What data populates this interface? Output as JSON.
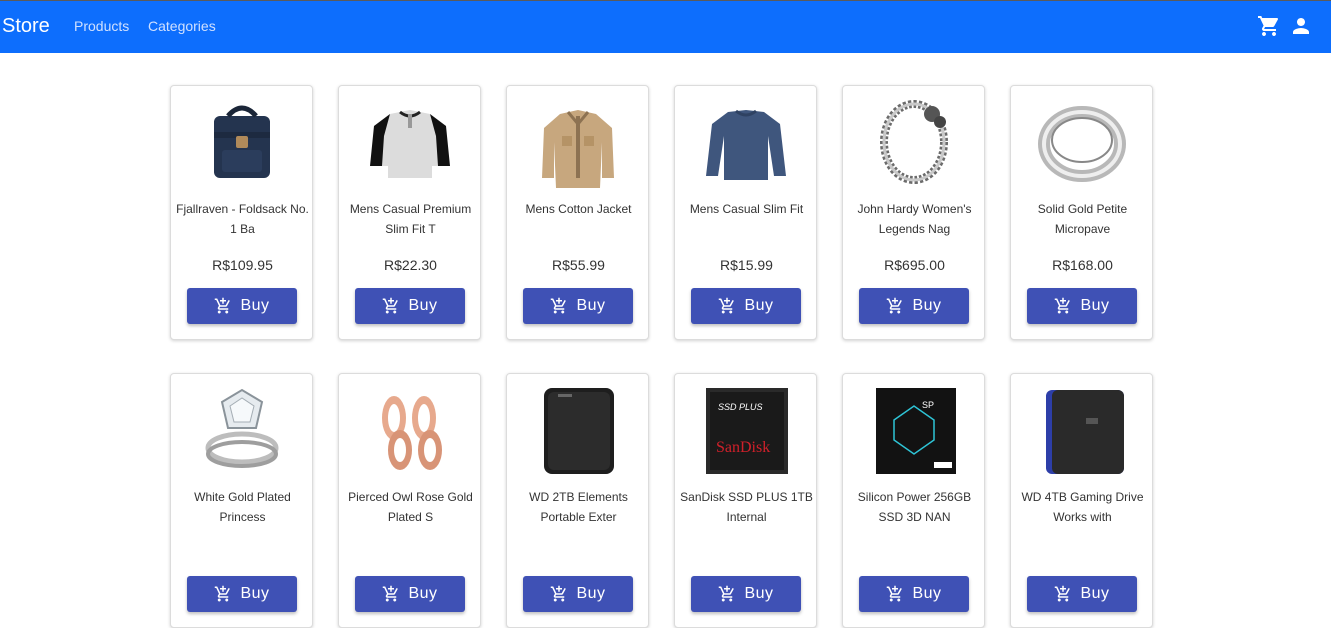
{
  "navbar": {
    "brand": "Store",
    "links": [
      "Products",
      "Categories"
    ],
    "icons": [
      "cart-icon",
      "user-icon"
    ],
    "background": "#0d6efd"
  },
  "button_color": "#3f51b5",
  "products": [
    {
      "title": "Fjallraven - Foldsack No. 1 Ba",
      "price": "R$109.95",
      "buy": "Buy",
      "icon": "backpack-image"
    },
    {
      "title": "Mens Casual Premium Slim Fit T",
      "price": "R$22.30",
      "buy": "Buy",
      "icon": "tshirt-image"
    },
    {
      "title": "Mens Cotton Jacket",
      "price": "R$55.99",
      "buy": "Buy",
      "icon": "jacket-image"
    },
    {
      "title": "Mens Casual Slim Fit",
      "price": "R$15.99",
      "buy": "Buy",
      "icon": "longsleeve-image"
    },
    {
      "title": "John Hardy Women's Legends Nag",
      "price": "R$695.00",
      "buy": "Buy",
      "icon": "bracelet-image"
    },
    {
      "title": "Solid Gold Petite Micropave",
      "price": "R$168.00",
      "buy": "Buy",
      "icon": "ring-image"
    },
    {
      "title": "White Gold Plated Princess",
      "price": "",
      "buy": "Buy",
      "icon": "diamond-ring-image"
    },
    {
      "title": "Pierced Owl Rose Gold Plated S",
      "price": "",
      "buy": "Buy",
      "icon": "plugs-image"
    },
    {
      "title": "WD 2TB Elements Portable Exter",
      "price": "",
      "buy": "Buy",
      "icon": "hdd-image"
    },
    {
      "title": "SanDisk SSD PLUS 1TB Internal",
      "price": "",
      "buy": "Buy",
      "icon": "ssd-image"
    },
    {
      "title": "Silicon Power 256GB SSD 3D NAN",
      "price": "",
      "buy": "Buy",
      "icon": "sp-ssd-image"
    },
    {
      "title": "WD 4TB Gaming Drive Works with",
      "price": "",
      "buy": "Buy",
      "icon": "gaming-drive-image"
    }
  ]
}
